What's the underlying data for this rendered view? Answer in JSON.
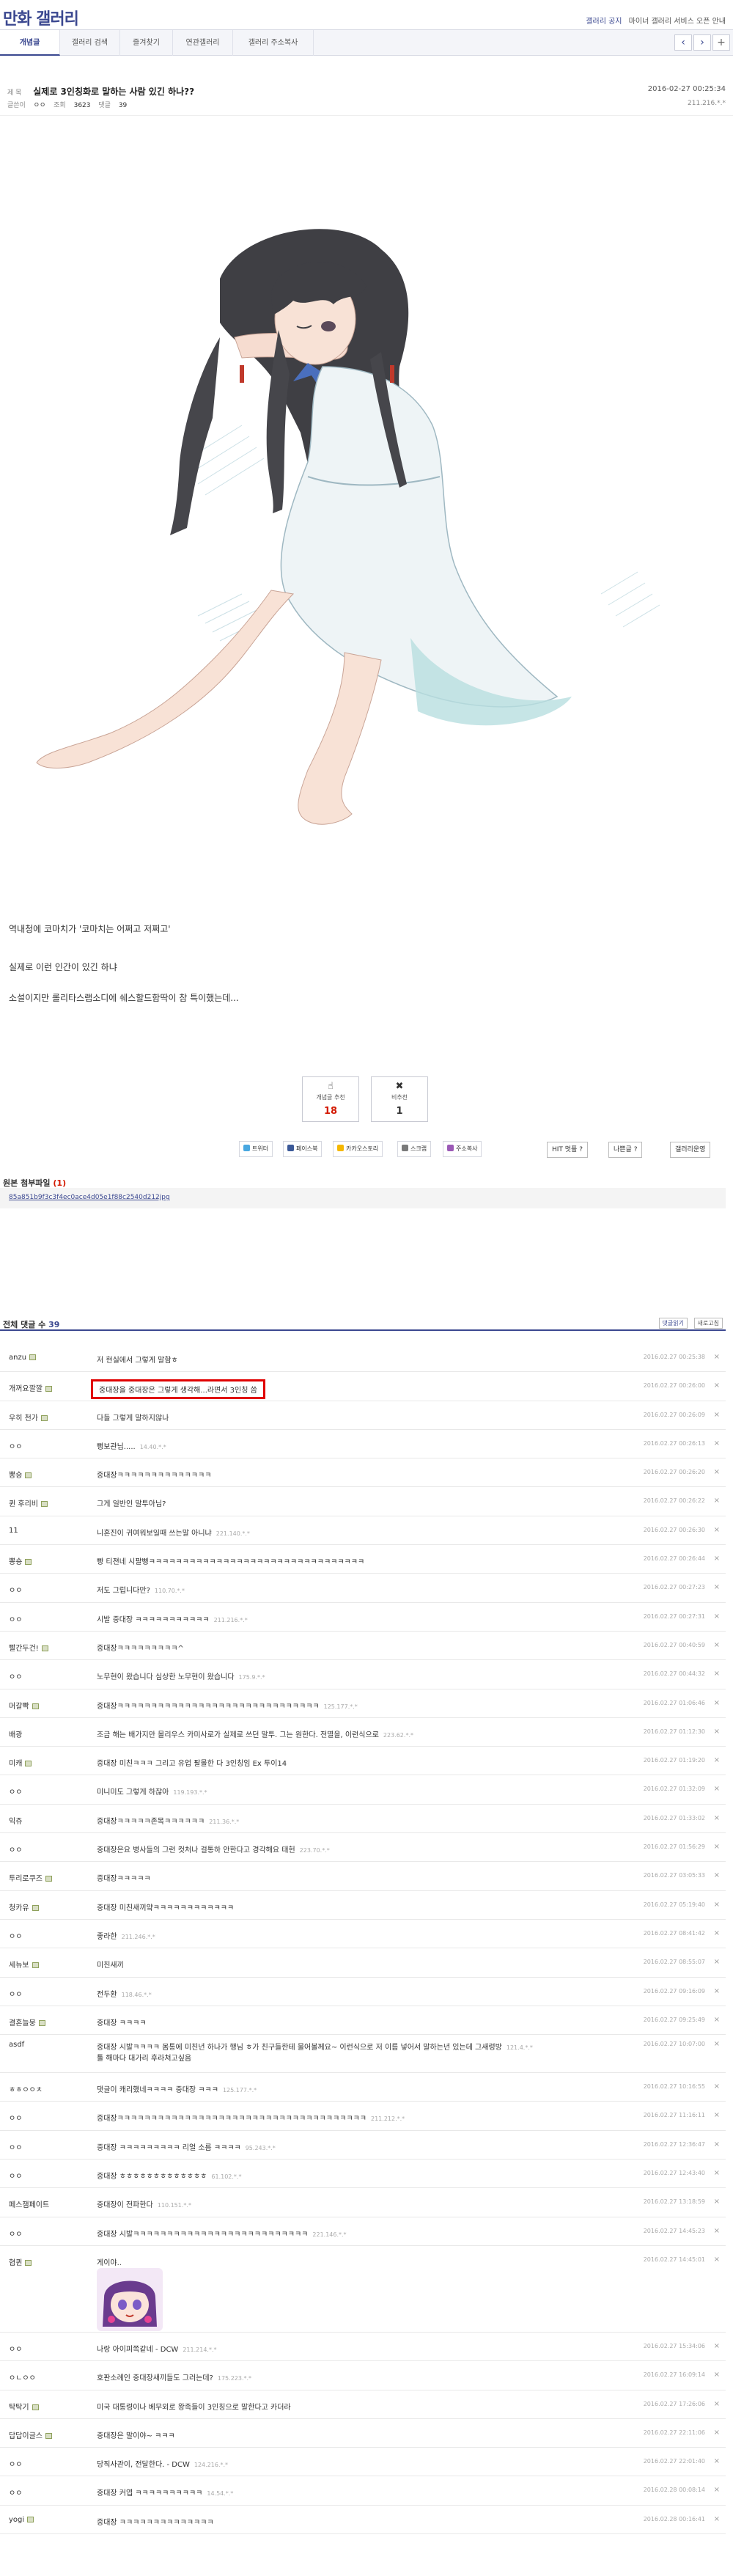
{
  "header": {
    "title_part1": "만화",
    "title_part2": "갤러리",
    "links": [
      "갤러리 공지",
      "마이너 갤러리 서비스 오픈 안내"
    ]
  },
  "tabs": [
    {
      "label": "개념글",
      "active": true
    },
    {
      "label": "갤러리 검색"
    },
    {
      "label": "즐겨찾기"
    },
    {
      "label": "연관갤러리"
    },
    {
      "label": "갤러리 주소복사"
    }
  ],
  "nav": {
    "prev": "‹",
    "next": "›",
    "more": "+"
  },
  "post": {
    "subject_label": "제 목",
    "title": "실제로 3인칭화로 말하는 사람 있긴 하나??",
    "date": "2016-02-27 00:25:34",
    "writer_label": "글쓴이",
    "writer": "ㅇㅇ",
    "views_label": "조회",
    "views": "3623",
    "comments_label": "댓글",
    "comments": "39",
    "ip": "211.216.*.*",
    "body": [
      "역내청에 코마치가 '코마치는 어쩌고 저쩌고'",
      "실제로 이런 인간이 있긴 하냐",
      "소설이지만 롤리타스랩소디에 쉐스할드함딱이 참 특이했는데..."
    ]
  },
  "recommend": {
    "up_label": "개념글 추천",
    "up_count": "18",
    "down_label": "비추천",
    "down_count": "1"
  },
  "share": [
    "트위터",
    "페이스북",
    "카카오스토리",
    "스크랩",
    "주소복사"
  ],
  "actions": [
    "HIT 멋플 ?",
    "나쁜글 ?",
    "갤러리운영"
  ],
  "attachment": {
    "title": "원본 첨부파일",
    "count": "(1)",
    "file": "85a851b9f3c3f4ec0ace4d05e1f88c2540d212jpg"
  },
  "comments_section": {
    "title": "전체 댓글 수",
    "count": "39",
    "btn1": "댓글읽기",
    "btn2": "새로고침"
  },
  "comments_list": [
    {
      "nick": "anzu",
      "icon": true,
      "msg": "저 현실에서 그렇게 말함ㅎ",
      "ip": "",
      "date": "2016.02.27 00:25:38"
    },
    {
      "nick": "개꺼요깔깔",
      "icon": true,
      "msg": "중대장을 중대장은 그렇게 생각해...라면서 3인칭 씀",
      "ip": "",
      "date": "2016.02.27 00:26:00",
      "highlight": true
    },
    {
      "nick": "우히 천가",
      "icon": true,
      "msg": "다들 그렇게 말하지않나",
      "ip": "",
      "date": "2016.02.27 00:26:09"
    },
    {
      "nick": "ㅇㅇ",
      "icon": false,
      "msg": "뻥보관님.....",
      "ip": "14.40.*.*",
      "date": "2016.02.27 00:26:13"
    },
    {
      "nick": "뽕숑",
      "icon": true,
      "msg": "중대장ㅋㅋㅋㅋㅋㅋㅋㅋㅋㅋㅋㅋㅋㅋ",
      "ip": "",
      "date": "2016.02.27 00:26:20"
    },
    {
      "nick": "퀸 후리비",
      "icon": true,
      "msg": "그게 일반인 말투아님?",
      "ip": "",
      "date": "2016.02.27 00:26:22"
    },
    {
      "nick": "11",
      "icon": false,
      "msg": "니혼진이 귀여워보일때 쓰는말 아니냐",
      "ip": "221.140.*.*",
      "date": "2016.02.27 00:26:30"
    },
    {
      "nick": "뽕숑",
      "icon": true,
      "msg": "빵 티젼네 시팔뻥ㅋㅋㅋㅋㅋㅋㅋㅋㅋㅋㅋㅋㅋㅋㅋㅋㅋㅋㅋㅋㅋㅋㅋㅋㅋㅋㅋㅋㅋㅋㅋㅋ",
      "ip": "",
      "date": "2016.02.27 00:26:44"
    },
    {
      "nick": "ㅇㅇ",
      "icon": false,
      "msg": "저도 그럽니다만?",
      "ip": "110.70.*.*",
      "date": "2016.02.27 00:27:23"
    },
    {
      "nick": "ㅇㅇ",
      "icon": false,
      "msg": "시발 중대장 ㅋㅋㅋㅋㅋㅋㅋㅋㅋㅋㅋ",
      "ip": "211.216.*.*",
      "date": "2016.02.27 00:27:31"
    },
    {
      "nick": "빨간두건!",
      "icon": true,
      "msg": "중대장ㅋㅋㅋㅋㅋㅋㅋㅋㅋ^",
      "ip": "",
      "date": "2016.02.27 00:40:59"
    },
    {
      "nick": "ㅇㅇ",
      "icon": false,
      "msg": "노무현이 왔습니다 심상한 노무현이 왔습니다",
      "ip": "175.9.*.*",
      "date": "2016.02.27 00:44:32"
    },
    {
      "nick": "머갈빡",
      "icon": true,
      "msg": "중대장ㅋㅋㅋㅋㅋㅋㅋㅋㅋㅋㅋㅋㅋㅋㅋㅋㅋㅋㅋㅋㅋㅋㅋㅋㅋㅋㅋㅋㅋㅋ",
      "ip": "125.177.*.*",
      "date": "2016.02.27 01:06:46"
    },
    {
      "nick": "배광",
      "icon": false,
      "msg": "조금 해는 배가지만 몰리우스 카미사로가 실제로 쓰던 말투. 그는 원한다. 전멸을, 이런식으로",
      "ip": "223.62.*.*",
      "date": "2016.02.27 01:12:30"
    },
    {
      "nick": "미캐",
      "icon": true,
      "msg": "중대장 미친ㅋㅋㅋ 그리고 유업 팔몰한 다 3인칭임 Ex 투이14",
      "ip": "",
      "date": "2016.02.27 01:19:20"
    },
    {
      "nick": "ㅇㅇ",
      "icon": false,
      "msg": "미니미도 그렇게 하잖아",
      "ip": "119.193.*.*",
      "date": "2016.02.27 01:32:09"
    },
    {
      "nick": "익쥬",
      "icon": false,
      "msg": "중대장ㅋㅋㅋㅋㅋ존목ㅋㅋㅋㅋㅋㅋ",
      "ip": "211.36.*.*",
      "date": "2016.02.27 01:33:02"
    },
    {
      "nick": "ㅇㅇ",
      "icon": false,
      "msg": "중대장은요 병사들의 그런 컷처나 걸통하 안한다고 경각해요 태헌",
      "ip": "223.70.*.*",
      "date": "2016.02.27 01:56:29"
    },
    {
      "nick": "투리로쿠즈",
      "icon": true,
      "msg": "중대장ㅋㅋㅋㅋㅋ",
      "ip": "",
      "date": "2016.02.27 03:05:33"
    },
    {
      "nick": "청카유",
      "icon": true,
      "msg": "중대장 미친새끼얔ㅋㅋㅋㅋㅋㅋㅋㅋㅋㅋㅋㅋ",
      "ip": "",
      "date": "2016.02.27 05:19:40"
    },
    {
      "nick": "ㅇㅇ",
      "icon": false,
      "msg": "좋라한",
      "ip": "211.246.*.*",
      "date": "2016.02.27 08:41:42"
    },
    {
      "nick": "세뉴보",
      "icon": true,
      "msg": "미친새끼",
      "ip": "",
      "date": "2016.02.27 08:55:07"
    },
    {
      "nick": "ㅇㅇ",
      "icon": false,
      "msg": "전두환",
      "ip": "118.46.*.*",
      "date": "2016.02.27 09:16:09"
    },
    {
      "nick": "결혼늘뭉",
      "icon": true,
      "msg": "중대장 ㅋㅋㅋㅋ",
      "ip": "",
      "date": "2016.02.27 09:25:49"
    },
    {
      "nick": "asdf",
      "icon": false,
      "msg": "중대장 시발ㅋㅋㅋㅋ 몸통에 미친년 하나가 행님 ㅎ가 친구들한테 물어볼께요~ 이런식으로 저 이름 넣어서 말하는년 있는데 그새렁방",
      "msg2": "툴 해마다 대가리 후라쳐고싶음",
      "ip": "121.4.*.*",
      "date": "2016.02.27 10:07:00",
      "tall": true
    },
    {
      "nick": "ㅎㅎㅇㅇㅊ",
      "icon": false,
      "msg": "댓글이 캐리했네ㅋㅋㅋㅋ 중대장 ㅋㅋㅋ",
      "ip": "125.177.*.*",
      "date": "2016.02.27 10:16:55"
    },
    {
      "nick": "ㅇㅇ",
      "icon": false,
      "msg": "중대장ㅋㅋㅋㅋㅋㅋㅋㅋㅋㅋㅋㅋㅋㅋㅋㅋㅋㅋㅋㅋㅋㅋㅋㅋㅋㅋㅋㅋㅋㅋㅋㅋㅋㅋㅋㅋㅋ",
      "ip": "211.212.*.*",
      "date": "2016.02.27 11:16:11"
    },
    {
      "nick": "ㅇㅇ",
      "icon": false,
      "msg": "중대장 ㅋㅋㅋㅋㅋㅋㅋㅋㅋ 리얼 소름 ㅋㅋㅋㅋ",
      "ip": "95.243.*.*",
      "date": "2016.02.27 12:36:47"
    },
    {
      "nick": "ㅇㅇ",
      "icon": false,
      "msg": "중대장 ㅎㅎㅎㅎㅎㅎㅎㅎㅎㅎㅎㅎㅎ",
      "ip": "61.102.*.*",
      "date": "2016.02.27 12:43:40"
    },
    {
      "nick": "페스잼페이트",
      "icon": false,
      "msg": "중대장이 전파한다",
      "ip": "110.151.*.*",
      "date": "2016.02.27 13:18:59"
    },
    {
      "nick": "ㅇㅇ",
      "icon": false,
      "msg": "중대장 시발ㅋㅋㅋㅋㅋㅋㅋㅋㅋㅋㅋㅋㅋㅋㅋㅋㅋㅋㅋㅋㅋㅋㅋㅋㅋㅋ",
      "ip": "221.146.*.*",
      "date": "2016.02.27 14:45:23"
    },
    {
      "nick": "협퀸",
      "icon": true,
      "msg": "게이야..",
      "ip": "",
      "date": "2016.02.27 14:45:01",
      "dccon": true
    },
    {
      "nick": "ㅇㅇ",
      "icon": false,
      "msg": "나랑 아이피쪽같네 - DCW",
      "ip": "211.214.*.*",
      "date": "2016.02.27 15:34:06"
    },
    {
      "nick": "ㅇㄴㅇㅇ",
      "icon": false,
      "msg": "호판소례인 중대장새끼들도 그러는데?",
      "ip": "175.223.*.*",
      "date": "2016.02.27 16:09:14"
    },
    {
      "nick": "탁탁기",
      "icon": true,
      "msg": "미국 대통령이나 베무외로 왕족들이 3인칭으로 말한다고 카더라",
      "ip": "",
      "date": "2016.02.27 17:26:06"
    },
    {
      "nick": "답답이글스",
      "icon": true,
      "msg": "중대장은 말이야~ ㅋㅋㅋ",
      "ip": "",
      "date": "2016.02.27 22:11:06"
    },
    {
      "nick": "ㅇㅇ",
      "icon": false,
      "msg": "당직사관이, 전달한다. - DCW",
      "ip": "124.216.*.*",
      "date": "2016.02.27 22:01:40"
    },
    {
      "nick": "ㅇㅇ",
      "icon": false,
      "msg": "중대장 커엽 ㅋㅋㅋㅋㅋㅋㅋㅋㅋㅋ",
      "ip": "14.54.*.*",
      "date": "2016.02.28 00:08:14"
    },
    {
      "nick": "yogi",
      "icon": true,
      "msg": "중대장 ㅋㅋㅋㅋㅋㅋㅋㅋㅋㅋㅋㅋㅋㅋ",
      "ip": "",
      "date": "2016.02.28 00:16:41"
    }
  ]
}
